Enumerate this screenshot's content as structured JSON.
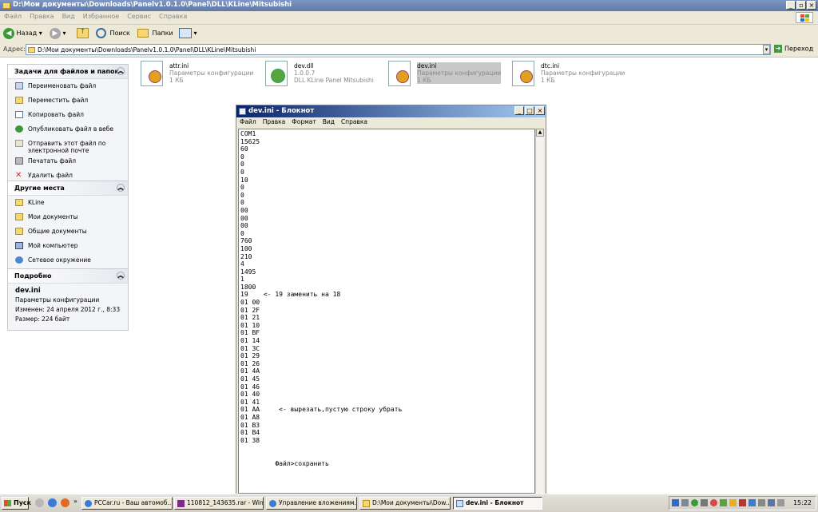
{
  "explorer": {
    "title": "D:\\Мои документы\\Downloads\\Panelv1.0.1.0\\Panel\\DLL\\KLine\\Mitsubishi",
    "menu": [
      "Файл",
      "Правка",
      "Вид",
      "Избранное",
      "Сервис",
      "Справка"
    ],
    "toolbar": {
      "back": "Назад",
      "search": "Поиск",
      "folders": "Папки"
    },
    "address_label": "Адрес:",
    "address_value": "D:\\Мои документы\\Downloads\\Panelv1.0.1.0\\Panel\\DLL\\KLine\\Mitsubishi",
    "go": "Переход"
  },
  "tasks": {
    "title": "Задачи для файлов и папок",
    "items": [
      "Переименовать файл",
      "Переместить файл",
      "Копировать файл",
      "Опубликовать файл в вебе",
      "Отправить этот файл по электронной почте",
      "Печатать файл",
      "Удалить файл"
    ]
  },
  "places": {
    "title": "Другие места",
    "items": [
      "KLine",
      "Мои документы",
      "Общие документы",
      "Мой компьютер",
      "Сетевое окружение"
    ]
  },
  "details": {
    "title": "Подробно",
    "name": "dev.ini",
    "type": "Параметры конфигурации",
    "modified": "Изменен: 24 апреля 2012 г., 8:33",
    "size": "Размер: 224 байт"
  },
  "files": [
    {
      "name": "attr.ini",
      "desc": "Параметры конфигурации",
      "size": "1 КБ"
    },
    {
      "name": "dev.dll",
      "desc": "1.0.0.7",
      "size": "DLL KLine Panel Mitsubishi"
    },
    {
      "name": "dev.ini",
      "desc": "Параметры конфигурации",
      "size": "1 КБ"
    },
    {
      "name": "dtc.ini",
      "desc": "Параметры конфигурации",
      "size": "1 КБ"
    }
  ],
  "notepad": {
    "title": "dev.ini - Блокнот",
    "menu": [
      "Файл",
      "Правка",
      "Формат",
      "Вид",
      "Справка"
    ],
    "content": "COM1\n15625\n60\n0\n0\n0\n10\n0\n0\n0\n00\n00\n00\n0\n760\n100\n210\n4\n1495\n1\n1800\n19    <- 19 заменить на 18\n01 00\n01 2F\n01 21\n01 10\n01 BF\n01 14\n01 3C\n01 29\n01 26\n01 4A\n01 45\n01 46\n01 40\n01 41\n01 AA     <- вырезать,пустую строку убрать\n01 A8\n01 B3\n01 B4\n01 38\n\n\n         Файл>сохранить"
  },
  "taskbar": {
    "start": "Пуск",
    "tasks": [
      "PCCar.ru - Ваш автомоб...",
      "110812_143635.rar - Win...",
      "Управление вложениям...",
      "D:\\Мои документы\\Dow...",
      "dev.ini - Блокнот"
    ],
    "clock": "15:22"
  },
  "colors": {
    "xp_title": "#6f88b8",
    "notepad_title_start": "#0a246a",
    "notepad_title_end": "#a6caf0",
    "folder": "#f5d774",
    "taskbar": "#d4d0c8"
  }
}
